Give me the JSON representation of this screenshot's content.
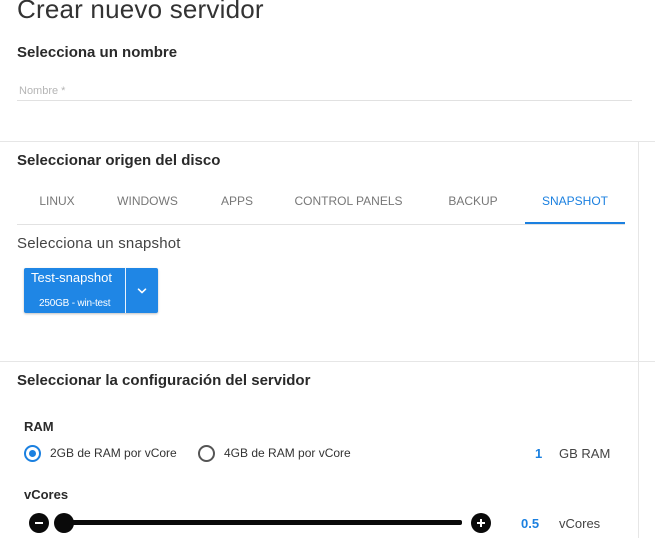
{
  "page": {
    "title": "Crear nuevo servidor"
  },
  "name_section": {
    "title": "Selecciona un nombre",
    "placeholder": "Nombre *",
    "value": ""
  },
  "disk_section": {
    "title": "Seleccionar origen del disco",
    "tabs": [
      {
        "label": "LINUX",
        "active": false
      },
      {
        "label": "WINDOWS",
        "active": false
      },
      {
        "label": "APPS",
        "active": false
      },
      {
        "label": "CONTROL PANELS",
        "active": false
      },
      {
        "label": "BACKUP",
        "active": false
      },
      {
        "label": "SNAPSHOT",
        "active": true
      }
    ],
    "snapshot_label": "Selecciona un snapshot",
    "snapshot": {
      "name": "Test-snapshot",
      "details": "250GB - win-test"
    }
  },
  "config_section": {
    "title": "Seleccionar la configuración del servidor",
    "ram": {
      "label": "RAM",
      "options": [
        {
          "label": "2GB de RAM por vCore",
          "selected": true
        },
        {
          "label": "4GB de RAM por vCore",
          "selected": false
        }
      ],
      "value": "1",
      "unit": "GB RAM"
    },
    "vcores": {
      "label": "vCores",
      "value": "0.5",
      "unit": "vCores",
      "slider_fraction": 0.0
    }
  },
  "colors": {
    "accent": "#1b80e0",
    "button": "#1f86e5",
    "dark": "#0a0a0a"
  },
  "icons": {
    "dropdown": "chevron-down-icon",
    "decrement": "minus-circle-icon",
    "increment": "plus-circle-icon"
  }
}
